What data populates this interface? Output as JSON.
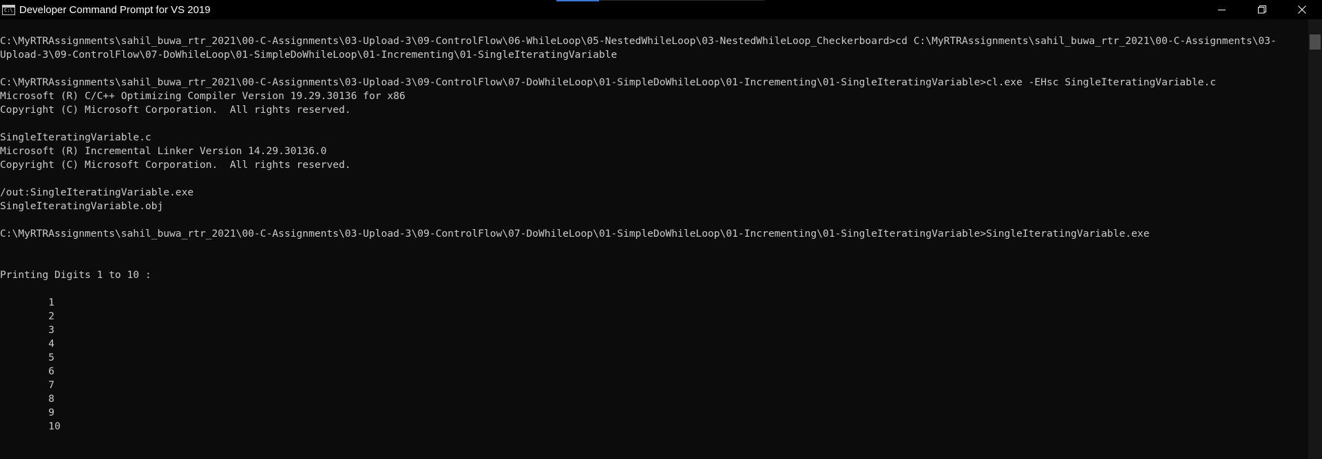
{
  "window": {
    "title": "Developer Command Prompt for VS 2019"
  },
  "icons": {
    "app": "command-prompt-icon",
    "minimize": "minimize-icon",
    "maximize": "restore-icon",
    "close": "close-icon"
  },
  "app_icon_text": "C:\\",
  "colors": {
    "background": "#0c0c0c",
    "text": "#cccccc",
    "titlebar": "#000000",
    "accent": "#3b78d8"
  },
  "console": {
    "lines": [
      "C:\\MyRTRAssignments\\sahil_buwa_rtr_2021\\00-C-Assignments\\03-Upload-3\\09-ControlFlow\\06-WhileLoop\\05-NestedWhileLoop\\03-NestedWhileLoop_Checkerboard>cd C:\\MyRTRAssignments\\sahil_buwa_rtr_2021\\00-C-Assignments\\03-",
      "Upload-3\\09-ControlFlow\\07-DoWhileLoop\\01-SimpleDoWhileLoop\\01-Incrementing\\01-SingleIteratingVariable",
      "",
      "C:\\MyRTRAssignments\\sahil_buwa_rtr_2021\\00-C-Assignments\\03-Upload-3\\09-ControlFlow\\07-DoWhileLoop\\01-SimpleDoWhileLoop\\01-Incrementing\\01-SingleIteratingVariable>cl.exe -EHsc SingleIteratingVariable.c",
      "Microsoft (R) C/C++ Optimizing Compiler Version 19.29.30136 for x86",
      "Copyright (C) Microsoft Corporation.  All rights reserved.",
      "",
      "SingleIteratingVariable.c",
      "Microsoft (R) Incremental Linker Version 14.29.30136.0",
      "Copyright (C) Microsoft Corporation.  All rights reserved.",
      "",
      "/out:SingleIteratingVariable.exe",
      "SingleIteratingVariable.obj",
      "",
      "C:\\MyRTRAssignments\\sahil_buwa_rtr_2021\\00-C-Assignments\\03-Upload-3\\09-ControlFlow\\07-DoWhileLoop\\01-SimpleDoWhileLoop\\01-Incrementing\\01-SingleIteratingVariable>SingleIteratingVariable.exe",
      "",
      "",
      "Printing Digits 1 to 10 :",
      "",
      "\t1",
      "\t2",
      "\t3",
      "\t4",
      "\t5",
      "\t6",
      "\t7",
      "\t8",
      "\t9",
      "\t10"
    ]
  }
}
